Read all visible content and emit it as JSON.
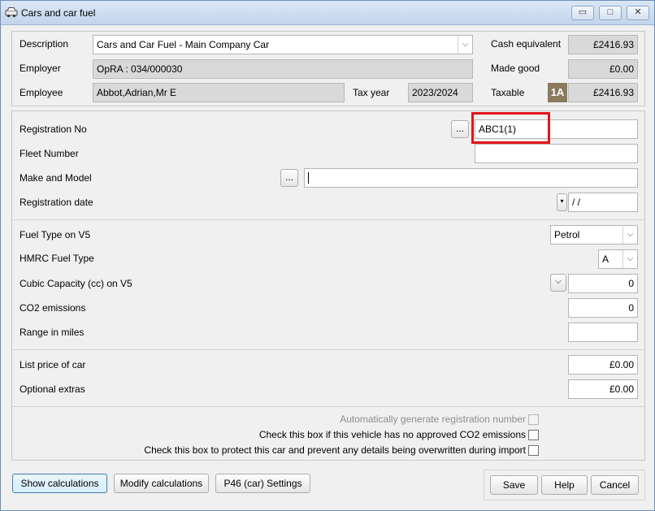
{
  "window": {
    "title": "Cars and car fuel",
    "min_glyph": "▭",
    "max_glyph": "□",
    "close_glyph": "✕"
  },
  "header": {
    "description_label": "Description",
    "description_value": "Cars and Car Fuel - Main Company Car",
    "employer_label": "Employer",
    "employer_value": "OpRA : 034/000030",
    "employee_label": "Employee",
    "employee_value": "Abbot,Adrian,Mr E",
    "tax_year_label": "Tax year",
    "tax_year_value": "2023/2024",
    "cash_equivalent_label": "Cash equivalent",
    "cash_equivalent_value": "£2416.93",
    "made_good_label": "Made good",
    "made_good_value": "£0.00",
    "taxable_label": "Taxable",
    "taxable_badge": "1A",
    "taxable_value": "£2416.93"
  },
  "vehicle": {
    "registration_label": "Registration No",
    "registration_value": "ABC1(1)",
    "ellipsis": "...",
    "fleet_label": "Fleet Number",
    "fleet_value": "",
    "make_model_label": "Make and Model",
    "make_model_value": "",
    "reg_date_label": "Registration date",
    "reg_date_value": " / /"
  },
  "fuel": {
    "fuel_type_label": "Fuel Type on V5",
    "fuel_type_value": "Petrol",
    "hmrc_fuel_label": "HMRC Fuel Type",
    "hmrc_fuel_value": "A",
    "cc_label": "Cubic Capacity (cc) on V5",
    "cc_value": "0",
    "co2_label": "CO2 emissions",
    "co2_value": "0",
    "range_label": "Range in miles",
    "range_value": ""
  },
  "price": {
    "list_price_label": "List price of car",
    "list_price_value": "£0.00",
    "optional_extras_label": "Optional extras",
    "optional_extras_value": "£0.00"
  },
  "options": {
    "auto_generate_label": "Automatically generate registration number",
    "no_co2_label": "Check this box if this vehicle has no approved CO2 emissions",
    "protect_label": "Check this box to protect this car and prevent any details being overwritten during import"
  },
  "footer": {
    "show_calculations": "Show calculations",
    "modify_calculations": "Modify calculations",
    "p46_settings": "P46 (car) Settings",
    "save": "Save",
    "help": "Help",
    "cancel": "Cancel"
  },
  "icons": {
    "dropdown": "⌵"
  }
}
